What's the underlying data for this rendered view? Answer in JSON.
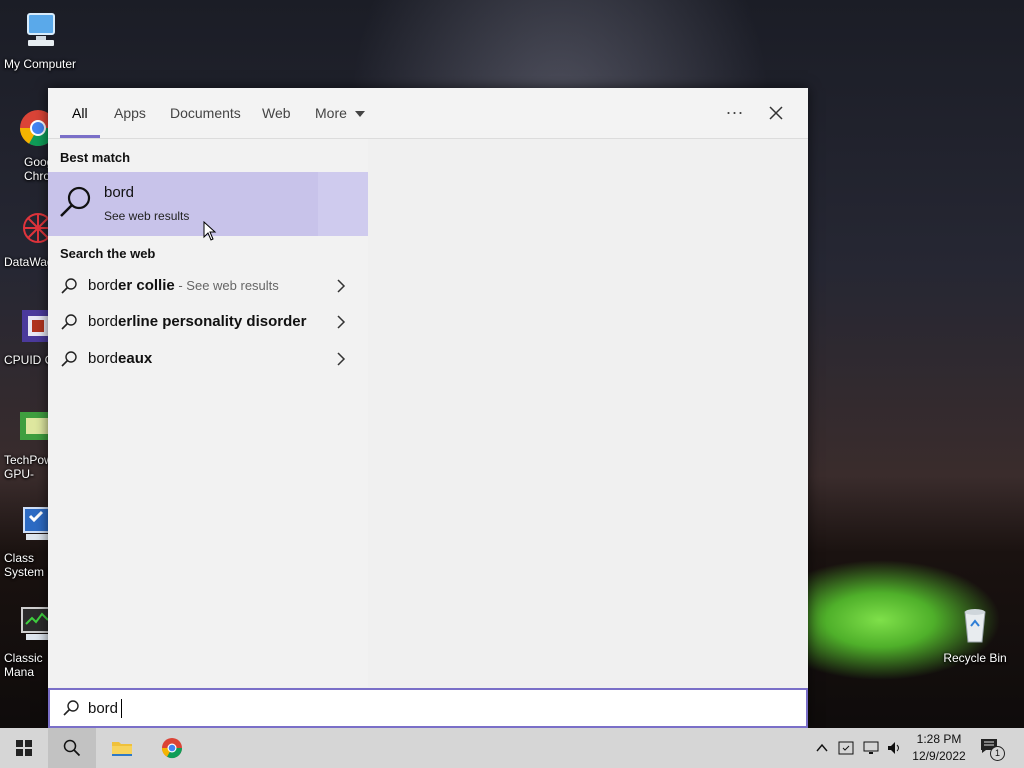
{
  "desktop_icons": [
    {
      "label": "My Computer",
      "icon": "computer-icon"
    },
    {
      "label": "Goog Chron",
      "icon": "chrome-icon"
    },
    {
      "label": "DataWag",
      "icon": "datawag-icon"
    },
    {
      "label": "CPUID C",
      "icon": "cpuid-icon"
    },
    {
      "label": "TechPow GPU-",
      "icon": "gpu-icon"
    },
    {
      "label": "Class System C",
      "icon": "system-config-icon"
    },
    {
      "label": "Classic Mana",
      "icon": "task-manager-icon"
    },
    {
      "label": "Recycle Bin",
      "icon": "recycle-bin-icon"
    }
  ],
  "search_panel": {
    "tabs": [
      "All",
      "Apps",
      "Documents",
      "Web",
      "More"
    ],
    "active_tab": "All",
    "more_menu_label": "...",
    "best_match_heading": "Best match",
    "best_match": {
      "title": "bord",
      "subtitle": "See web results"
    },
    "search_web_heading": "Search the web",
    "web_results": [
      {
        "typed": "bord",
        "completion": "er collie",
        "suffix": " - See web results"
      },
      {
        "typed": "bord",
        "completion": "erline personality disorder",
        "suffix": ""
      },
      {
        "typed": "bord",
        "completion": "eaux",
        "suffix": ""
      }
    ],
    "query": "bord"
  },
  "taskbar": {
    "time": "1:28 PM",
    "date": "12/9/2022",
    "notification_count": "1"
  },
  "colors": {
    "accent": "#7a6fc8",
    "best_match_bg": "#c8c3ea"
  }
}
